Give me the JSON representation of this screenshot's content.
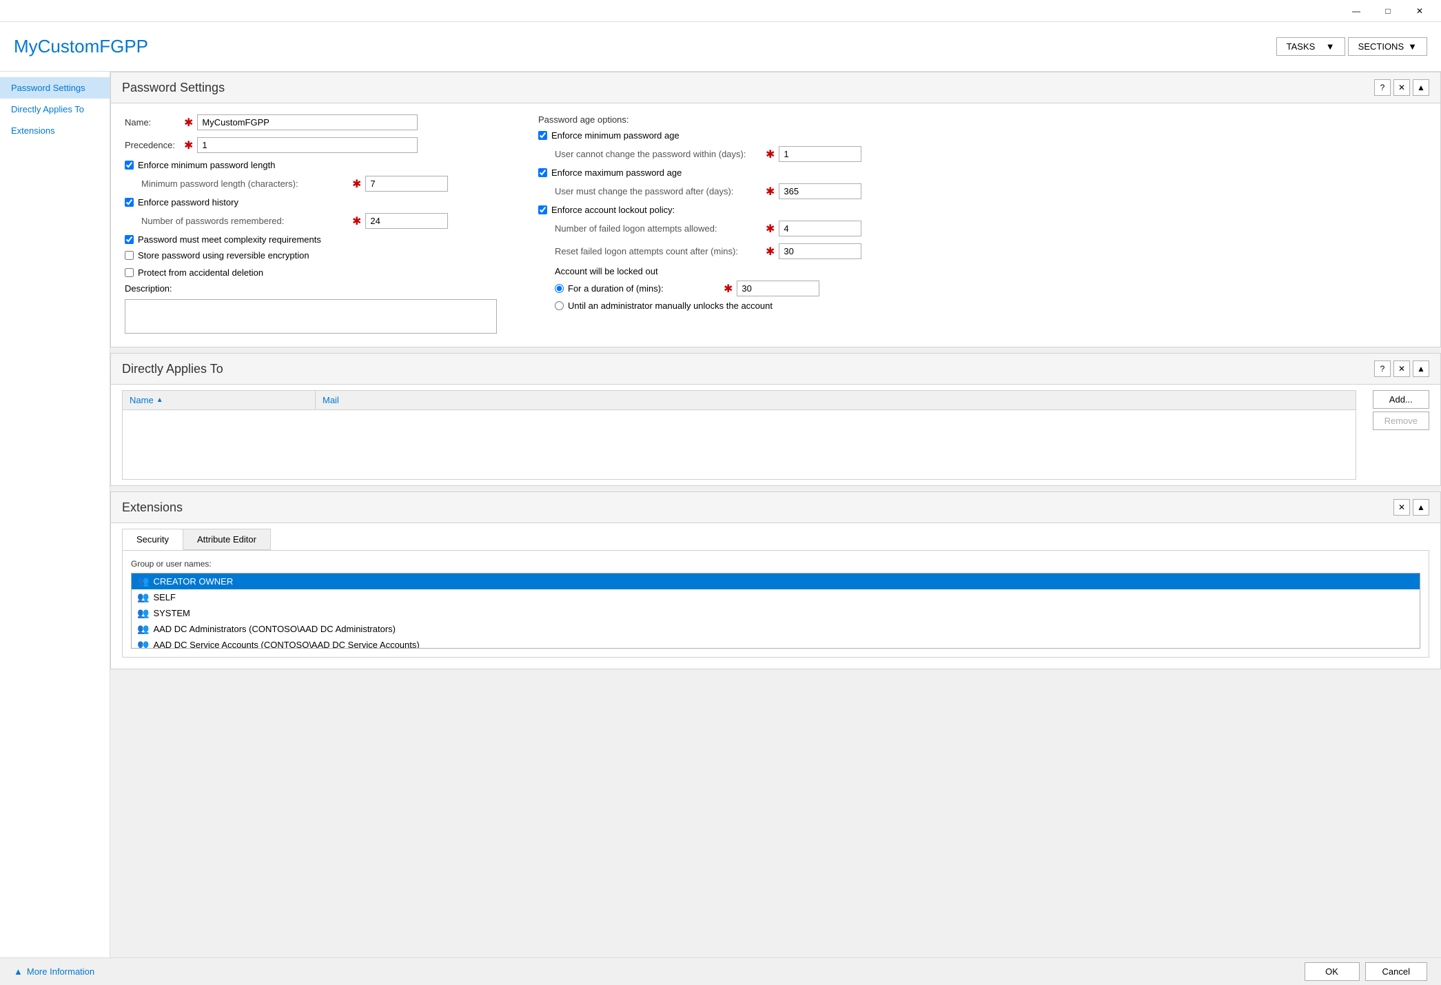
{
  "titlebar": {
    "minimize": "—",
    "maximize": "□",
    "close": "✕"
  },
  "header": {
    "title": "MyCustomFGPP",
    "tasks_label": "TASKS",
    "sections_label": "SECTIONS"
  },
  "sidebar": {
    "items": [
      {
        "label": "Password Settings",
        "id": "password-settings",
        "active": true
      },
      {
        "label": "Directly Applies To",
        "id": "directly-applies-to",
        "active": false
      },
      {
        "label": "Extensions",
        "id": "extensions",
        "active": false
      }
    ]
  },
  "password_settings": {
    "section_title": "Password Settings",
    "name_label": "Name:",
    "name_value": "MyCustomFGPP",
    "precedence_label": "Precedence:",
    "precedence_value": "1",
    "enforce_min_length_label": "Enforce minimum password length",
    "min_length_label": "Minimum password length (characters):",
    "min_length_value": "7",
    "enforce_history_label": "Enforce password history",
    "history_label": "Number of passwords remembered:",
    "history_value": "24",
    "complexity_label": "Password must meet complexity requirements",
    "reversible_label": "Store password using reversible encryption",
    "protect_deletion_label": "Protect from accidental deletion",
    "description_label": "Description:",
    "password_age_heading": "Password age options:",
    "enforce_min_age_label": "Enforce minimum password age",
    "min_age_sublabel": "User cannot change the password within (days):",
    "min_age_value": "1",
    "enforce_max_age_label": "Enforce maximum password age",
    "max_age_sublabel": "User must change the password after (days):",
    "max_age_value": "365",
    "enforce_lockout_label": "Enforce account lockout policy:",
    "failed_attempts_label": "Number of failed logon attempts allowed:",
    "failed_attempts_value": "4",
    "reset_label": "Reset failed logon attempts count after (mins):",
    "reset_value": "30",
    "account_locked_label": "Account will be locked out",
    "duration_label": "For a duration of (mins):",
    "duration_value": "30",
    "manual_unlock_label": "Until an administrator manually unlocks the account"
  },
  "directly_applies_to": {
    "section_title": "Directly Applies To",
    "col_name": "Name",
    "col_mail": "Mail",
    "add_label": "Add...",
    "remove_label": "Remove"
  },
  "extensions": {
    "section_title": "Extensions",
    "tabs": [
      {
        "label": "Security",
        "active": true
      },
      {
        "label": "Attribute Editor",
        "active": false
      }
    ],
    "group_label": "Group or user names:",
    "users": [
      {
        "name": "CREATOR OWNER",
        "selected": true
      },
      {
        "name": "SELF",
        "selected": false
      },
      {
        "name": "SYSTEM",
        "selected": false
      },
      {
        "name": "AAD DC Administrators (CONTOSO\\AAD DC Administrators)",
        "selected": false
      },
      {
        "name": "AAD DC Service Accounts (CONTOSO\\AAD DC Service Accounts)",
        "selected": false
      }
    ]
  },
  "bottom_bar": {
    "more_info_label": "More Information",
    "ok_label": "OK",
    "cancel_label": "Cancel"
  }
}
